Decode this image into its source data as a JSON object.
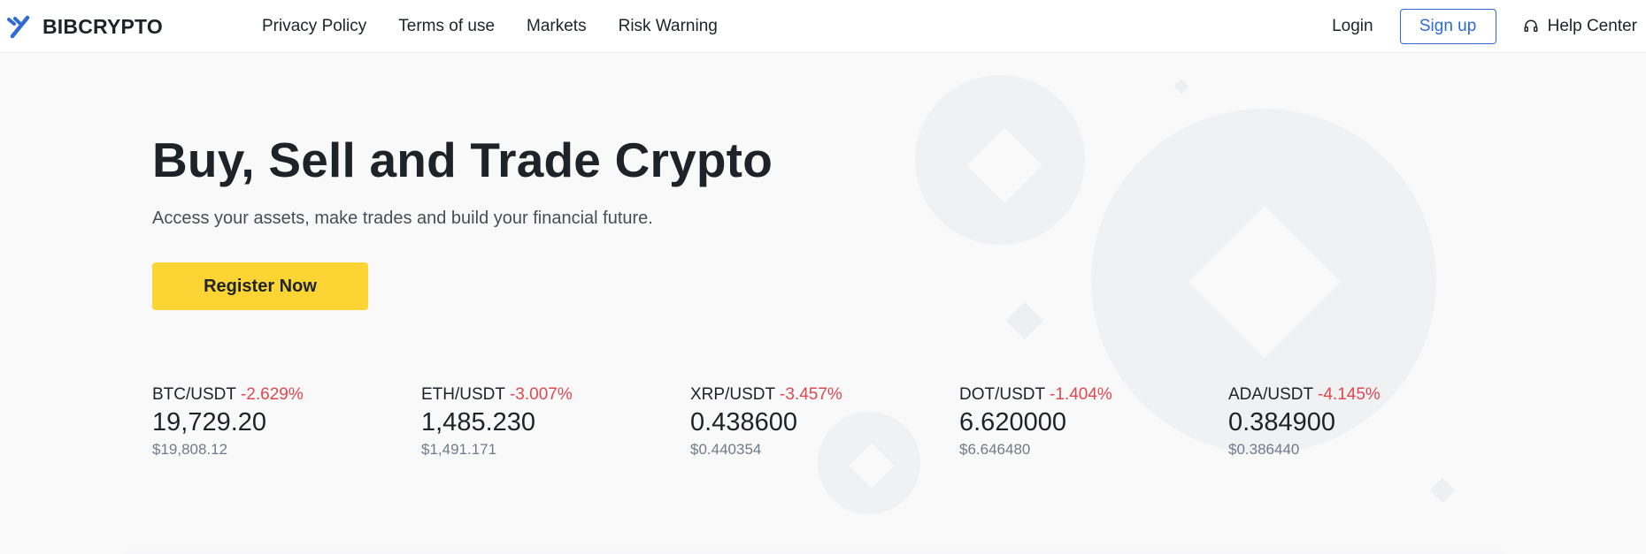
{
  "header": {
    "brand": "BIBCRYPTO",
    "nav": [
      "Privacy Policy",
      "Terms of use",
      "Markets",
      "Risk Warning"
    ],
    "login": "Login",
    "signup": "Sign up",
    "help": "Help Center"
  },
  "hero": {
    "title": "Buy, Sell and Trade Crypto",
    "subtitle": "Access your assets, make trades and build your financial future.",
    "cta": "Register Now"
  },
  "tickers": [
    {
      "pair": "BTC/USDT",
      "change": "-2.629%",
      "price": "19,729.20",
      "usd": "$19,808.12"
    },
    {
      "pair": "ETH/USDT",
      "change": "-3.007%",
      "price": "1,485.230",
      "usd": "$1,491.171"
    },
    {
      "pair": "XRP/USDT",
      "change": "-3.457%",
      "price": "0.438600",
      "usd": "$0.440354"
    },
    {
      "pair": "DOT/USDT",
      "change": "-1.404%",
      "price": "6.620000",
      "usd": "$6.646480"
    },
    {
      "pair": "ADA/USDT",
      "change": "-4.145%",
      "price": "0.384900",
      "usd": "$0.386440"
    }
  ],
  "colors": {
    "accent_blue": "#2f6bd6",
    "cta_yellow": "#fcd535",
    "negative_red": "#e0474f",
    "logo_blue": "#2f6bd6"
  }
}
